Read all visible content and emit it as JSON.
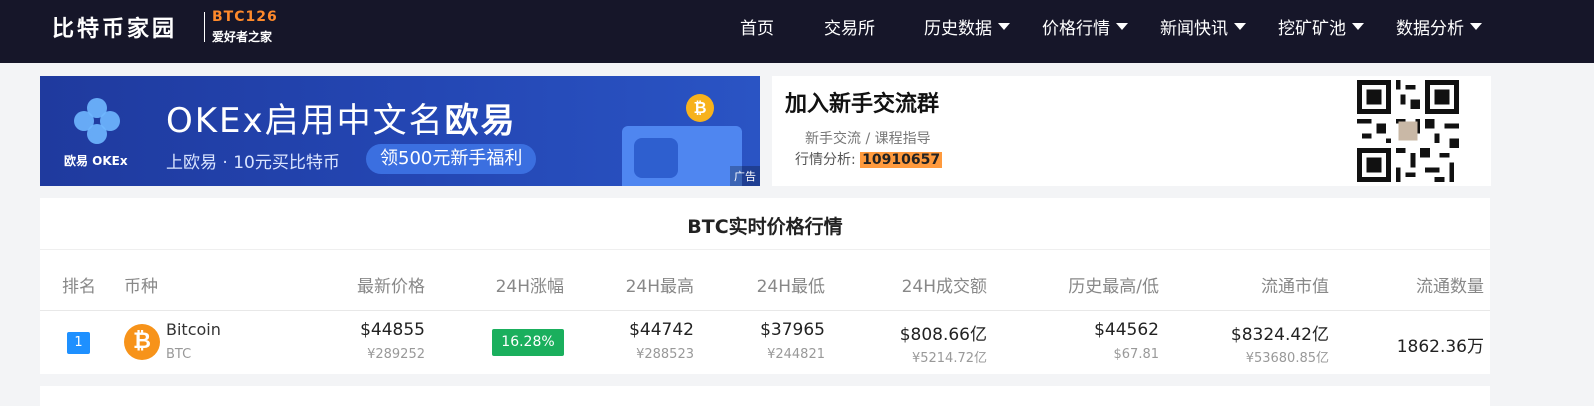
{
  "header": {
    "logo_main": "比特币家园",
    "logo_code": "BTC126",
    "logo_sub": "爱好者之家",
    "nav": [
      {
        "label": "首页",
        "dropdown": false
      },
      {
        "label": "交易所",
        "dropdown": false
      },
      {
        "label": "历史数据",
        "dropdown": true
      },
      {
        "label": "价格行情",
        "dropdown": true
      },
      {
        "label": "新闻快讯",
        "dropdown": true
      },
      {
        "label": "挖矿矿池",
        "dropdown": true
      },
      {
        "label": "数据分析",
        "dropdown": true
      }
    ]
  },
  "banner": {
    "brand": "欧易 OKEx",
    "title_prefix": "OKEx启用中文名",
    "title_bold": "欧易",
    "subtitle": "上欧易 · 10元买比特币",
    "pill": "领500元新手福利",
    "coin_glyph": "₿",
    "ad_tag": "广告"
  },
  "join": {
    "title": "加入新手交流群",
    "line1": "新手交流 / 课程指导",
    "line2_label": "行情分析:",
    "line2_number": "10910657"
  },
  "market": {
    "title": "BTC实时价格行情",
    "columns": [
      "排名",
      "币种",
      "最新价格",
      "24H涨幅",
      "24H最高",
      "24H最低",
      "24H成交额",
      "历史最高/低",
      "流通市值",
      "流通数量"
    ],
    "row": {
      "rank": "1",
      "coin_glyph": "₿",
      "name": "Bitcoin",
      "symbol": "BTC",
      "price_usd": "$44855",
      "price_cny": "¥289252",
      "change_24h": "16.28%",
      "high_usd": "$44742",
      "high_cny": "¥288523",
      "low_usd": "$37965",
      "low_cny": "¥244821",
      "volume_usd": "$808.66亿",
      "volume_cny": "¥5214.72亿",
      "ath": "$44562",
      "atl": "$67.81",
      "mcap_usd": "$8324.42亿",
      "mcap_cny": "¥53680.85亿",
      "supply": "1862.36万"
    }
  },
  "colors": {
    "header_bg": "#161629",
    "logo_accent": "#ff8a2b",
    "change_up": "#1aaf5d",
    "rank_badge": "#1e90ff",
    "btc_orange": "#f7931a"
  }
}
